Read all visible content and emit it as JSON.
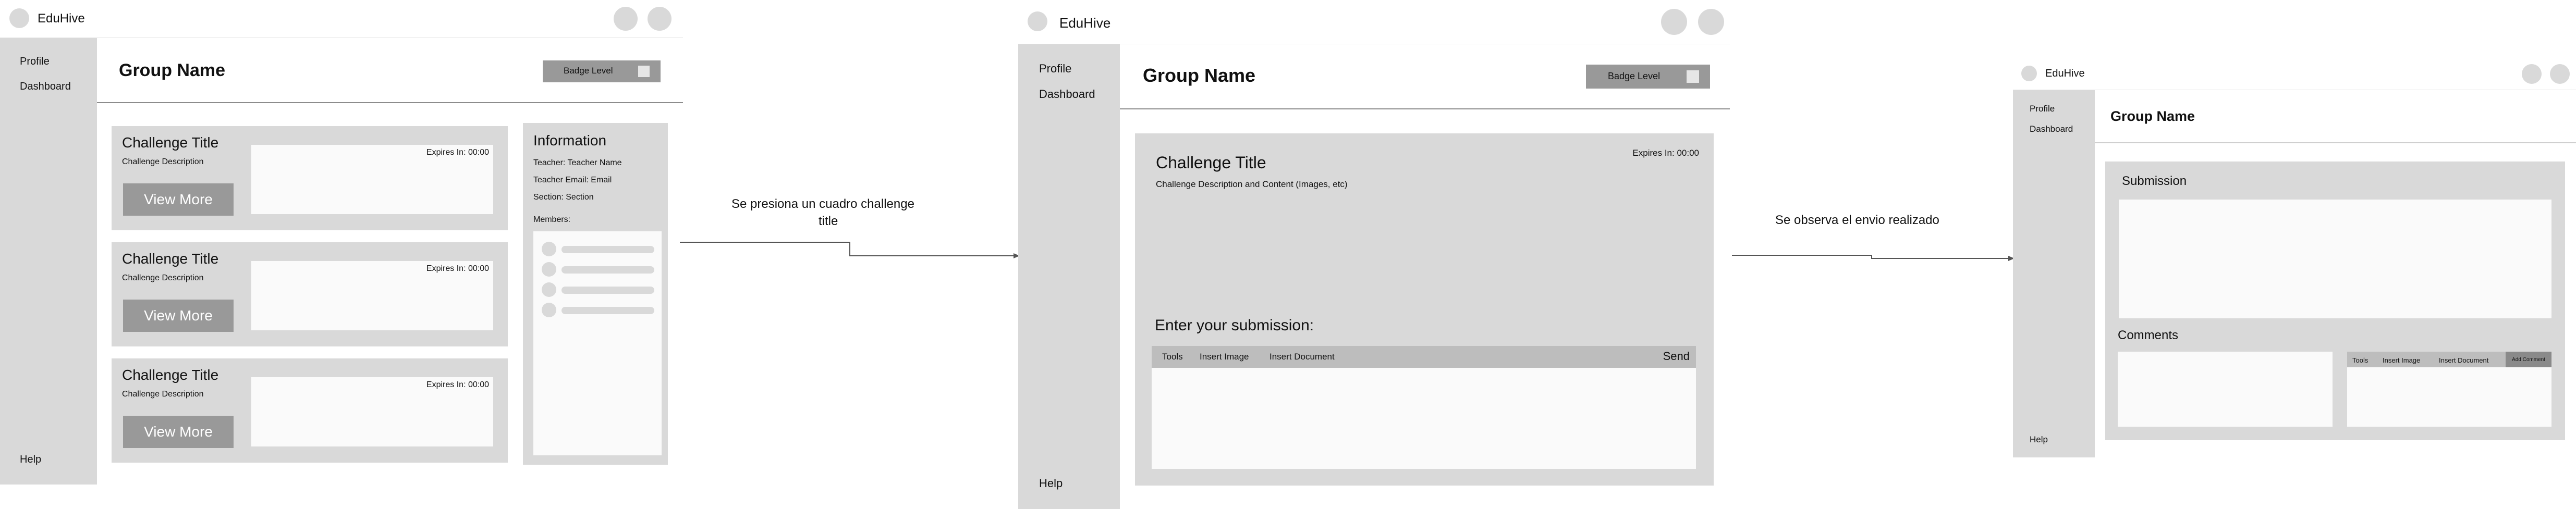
{
  "app": {
    "name": "EduHive"
  },
  "nav": {
    "profile": "Profile",
    "dashboard": "Dashboard",
    "help": "Help"
  },
  "group": {
    "name": "Group Name",
    "badge_label": "Badge Level"
  },
  "challenges": [
    {
      "title": "Challenge Title",
      "description": "Challenge Description",
      "expires": "Expires In: 00:00",
      "button": "View More"
    },
    {
      "title": "Challenge Title",
      "description": "Challenge Description",
      "expires": "Expires In: 00:00",
      "button": "View More"
    },
    {
      "title": "Challenge Title",
      "description": "Challenge Description",
      "expires": "Expires In: 00:00",
      "button": "View More"
    }
  ],
  "info": {
    "title": "Information",
    "teacher": "Teacher: Teacher Name",
    "email": "Teacher Email: Email",
    "section": "Section: Section",
    "members_label": "Members:"
  },
  "annotations": {
    "step1_line1": "Se presiona un cuadro challenge",
    "step1_line2": "title",
    "step2": "Se observa el envio realizado"
  },
  "detail": {
    "title": "Challenge Title",
    "expires": "Expires In: 00:00",
    "description": "Challenge Description and Content (Images, etc)",
    "submission_prompt": "Enter your submission:",
    "toolbar": {
      "tools": "Tools",
      "insert_image": "Insert Image",
      "insert_document": "Insert Document",
      "send": "Send"
    }
  },
  "result": {
    "submission_label": "Submission",
    "comments_label": "Comments",
    "toolbar": {
      "tools": "Tools",
      "insert_image": "Insert Image",
      "insert_document": "Insert Document",
      "add_comment": "Add Comment"
    }
  },
  "colors": {
    "panel": "#d9d9d9",
    "button": "#999999",
    "card": "#fafafa"
  }
}
